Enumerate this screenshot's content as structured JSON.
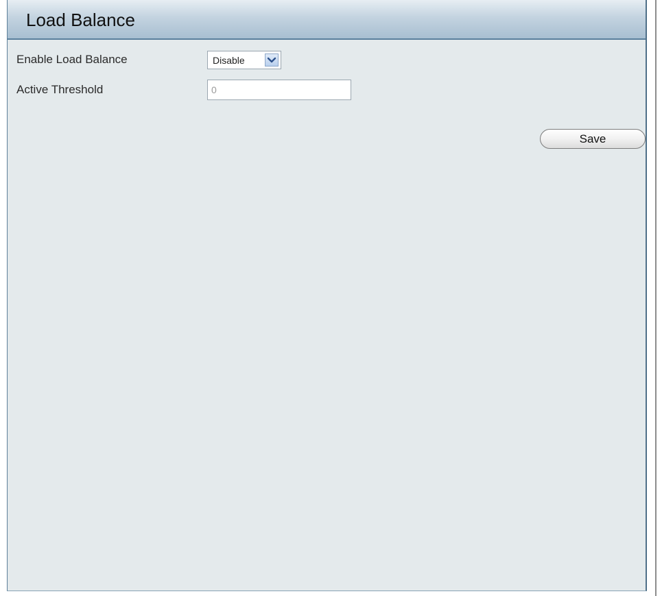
{
  "page": {
    "title": "Load Balance"
  },
  "form": {
    "enable": {
      "label": "Enable Load Balance",
      "selected": "Disable"
    },
    "threshold": {
      "label": "Active Threshold",
      "value": "0"
    }
  },
  "actions": {
    "save_label": "Save"
  },
  "icons": {
    "dropdown": "chevron-down-icon"
  },
  "colors": {
    "panel_background": "#e4eaec",
    "header_gradient_top": "#e7eef3",
    "header_gradient_bottom": "#a8bfd1",
    "border_accent": "#5a7f9c"
  }
}
